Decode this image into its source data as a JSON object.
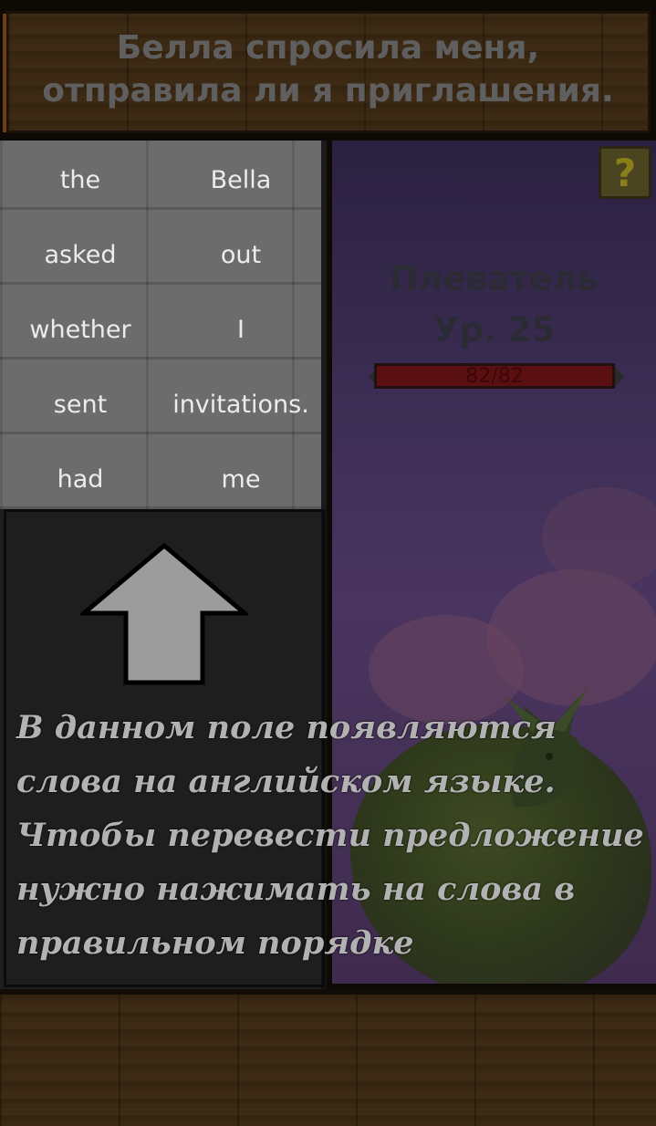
{
  "sentence": "Белла спросила меня, отправила ли я приглашения.",
  "words": [
    {
      "label": "the"
    },
    {
      "label": "Bella"
    },
    {
      "label": "asked"
    },
    {
      "label": "out"
    },
    {
      "label": "whether"
    },
    {
      "label": "I"
    },
    {
      "label": "sent"
    },
    {
      "label": "invitations."
    },
    {
      "label": "had"
    },
    {
      "label": "me"
    }
  ],
  "help_button": "?",
  "enemy": {
    "name": "Плеватель",
    "level": "Ур. 25",
    "hp_text": "82/82",
    "hp_fraction": 1.0
  },
  "tutorial": {
    "lines": [
      "В данном поле появляются",
      "слова на английском языке.",
      "Чтобы перевести предложение",
      "нужно нажимать на слова в",
      "правильном порядке"
    ]
  },
  "icons": {
    "arrow": "up-arrow-icon",
    "dragon": "dragon-icon"
  },
  "colors": {
    "board": "#6c6c6c",
    "wood": "#37250f",
    "hp": "#5a0f10",
    "sky": "#3b2d53"
  }
}
